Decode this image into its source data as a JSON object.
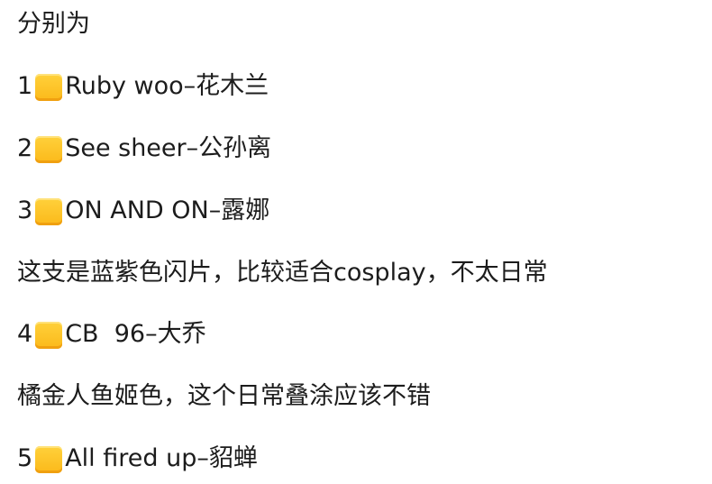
{
  "lines": [
    {
      "type": "text",
      "text": "分别为"
    },
    {
      "type": "item",
      "number": "1",
      "icon": "orange-square-emoji",
      "text": "Ruby woo–花木兰"
    },
    {
      "type": "item",
      "number": "2",
      "icon": "orange-square-emoji",
      "text": "See sheer–公孙离"
    },
    {
      "type": "item",
      "number": "3",
      "icon": "orange-square-emoji",
      "text": "ON AND ON–露娜"
    },
    {
      "type": "text",
      "text": "这支是蓝紫色闪片，比较适合cosplay，不太日常"
    },
    {
      "type": "item",
      "number": "4",
      "icon": "orange-square-emoji",
      "text": "CB  96–大乔"
    },
    {
      "type": "text",
      "text": "橘金人鱼姬色，这个日常叠涂应该不错"
    },
    {
      "type": "item",
      "number": "5",
      "icon": "orange-square-emoji",
      "text": "All fired up–貂蝉"
    }
  ],
  "colors": {
    "text": "#1c1c1c",
    "square": "#fbbf24",
    "background": "#ffffff"
  }
}
